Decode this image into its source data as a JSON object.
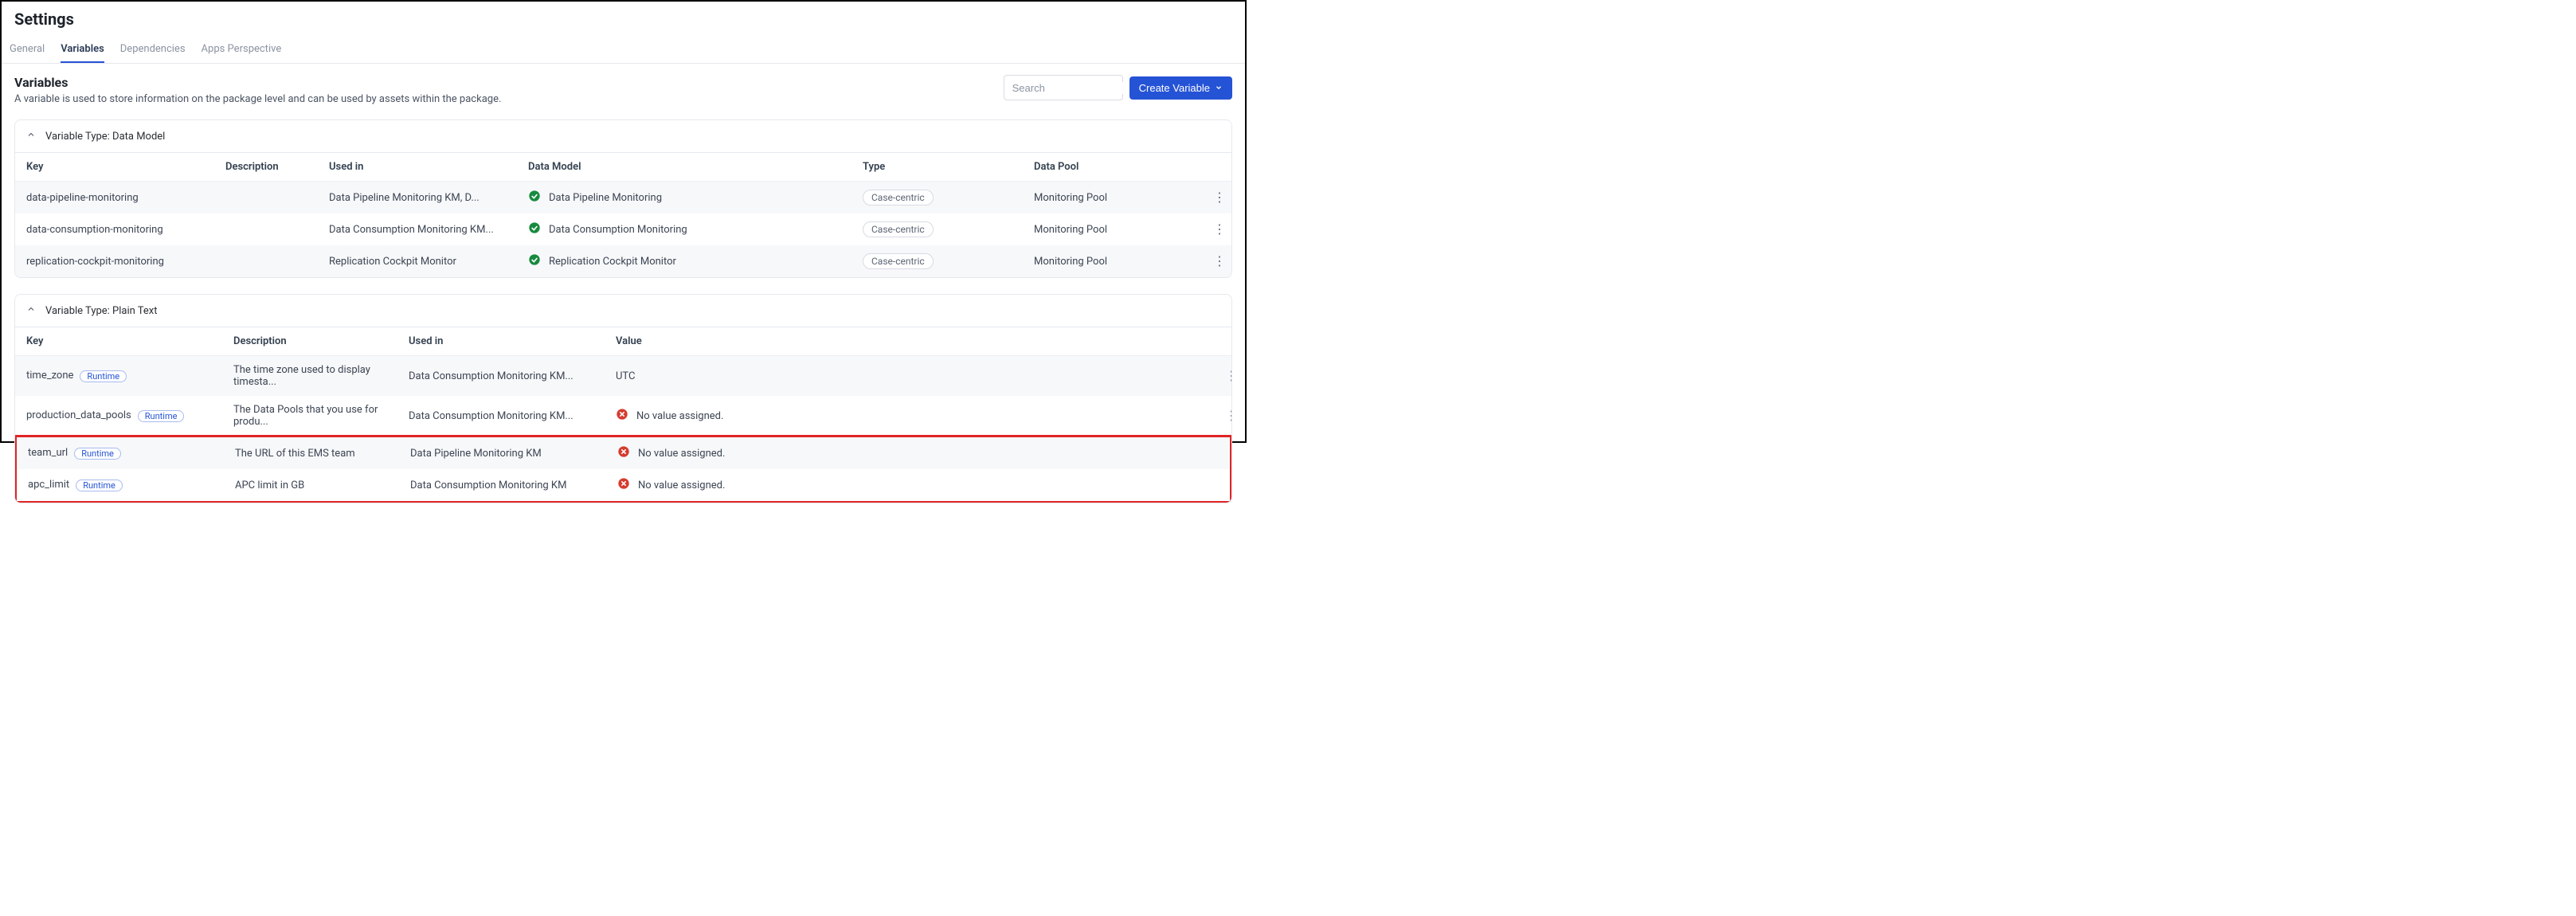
{
  "page_title": "Settings",
  "tabs": [
    "General",
    "Variables",
    "Dependencies",
    "Apps Perspective"
  ],
  "active_tab_index": 1,
  "section": {
    "title": "Variables",
    "description": "A variable is used to store information on the package level and can be used by assets within the package."
  },
  "search_placeholder": "Search",
  "create_button": "Create Variable",
  "group_a": {
    "title": "Variable Type: Data Model",
    "headers": [
      "Key",
      "Description",
      "Used in",
      "Data Model",
      "Type",
      "Data Pool"
    ],
    "rows": [
      {
        "key": "data-pipeline-monitoring",
        "desc": "",
        "used_in": "Data Pipeline Monitoring KM, D...",
        "data_model": "Data Pipeline Monitoring",
        "type": "Case-centric",
        "data_pool": "Monitoring Pool"
      },
      {
        "key": "data-consumption-monitoring",
        "desc": "",
        "used_in": "Data Consumption Monitoring KM...",
        "data_model": "Data Consumption Monitoring",
        "type": "Case-centric",
        "data_pool": "Monitoring Pool"
      },
      {
        "key": "replication-cockpit-monitoring",
        "desc": "",
        "used_in": "Replication Cockpit Monitor",
        "data_model": "Replication Cockpit Monitor",
        "type": "Case-centric",
        "data_pool": "Monitoring Pool"
      }
    ]
  },
  "group_b": {
    "title": "Variable Type: Plain Text",
    "headers": [
      "Key",
      "Description",
      "Used in",
      "Value"
    ],
    "rows_top": [
      {
        "key": "time_zone",
        "desc": "The time zone used to display timesta...",
        "used_in": "Data Consumption Monitoring KM...",
        "value": "UTC",
        "has_value": true
      },
      {
        "key": "production_data_pools",
        "desc": "The Data Pools that you use for produ...",
        "used_in": "Data Consumption Monitoring KM...",
        "value": "No value assigned.",
        "has_value": false
      }
    ],
    "rows_hl": [
      {
        "key": "team_url",
        "desc": "The URL of this EMS team",
        "used_in": "Data Pipeline Monitoring KM",
        "value": "No value assigned.",
        "has_value": false
      },
      {
        "key": "apc_limit",
        "desc": "APC limit in GB",
        "used_in": "Data Consumption Monitoring KM",
        "value": "No value assigned.",
        "has_value": false
      }
    ],
    "runtime_label": "Runtime"
  }
}
